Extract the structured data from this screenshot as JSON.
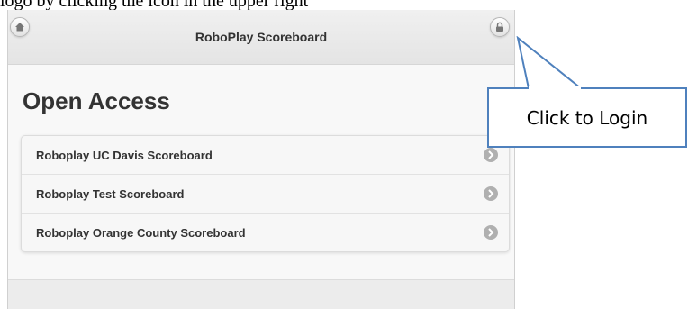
{
  "document": {
    "caption_fragment": "logo by clicking the icon in the upper right"
  },
  "app": {
    "title": "RoboPlay Scoreboard",
    "home_icon": "home-icon",
    "login_icon": "lock-icon"
  },
  "main": {
    "section_title": "Open Access",
    "items": [
      {
        "label": "Roboplay UC Davis Scoreboard",
        "icon": "chevron-right-icon"
      },
      {
        "label": "Roboplay Test Scoreboard",
        "icon": "chevron-right-icon"
      },
      {
        "label": "Roboplay Orange County Scoreboard",
        "icon": "chevron-right-icon"
      }
    ]
  },
  "callout": {
    "text": "Click to Login",
    "border_color": "#4f81bd"
  }
}
